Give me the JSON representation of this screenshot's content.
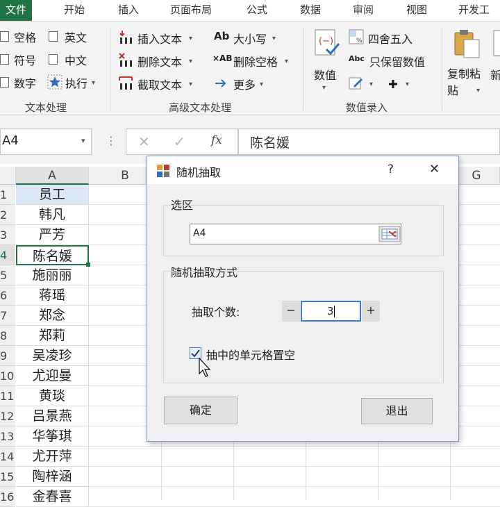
{
  "ribbon": {
    "tabs": [
      "文件",
      "开始",
      "插入",
      "页面布局",
      "公式",
      "数据",
      "审阅",
      "视图",
      "开发工"
    ],
    "text_group": {
      "label": "文本处理",
      "items": [
        "空格",
        "符号",
        "数字",
        "英文",
        "中文",
        "执行"
      ]
    },
    "advanced_group": {
      "label": "高级文本处理",
      "items": [
        "插入文本",
        "删除文本",
        "截取文本",
        "大小写",
        "删除空格",
        "更多"
      ]
    },
    "numeric_group": {
      "label": "数值录入",
      "value_button": "数值",
      "items": [
        "四舍五入",
        "只保留数值"
      ]
    },
    "copy_paste": "复制粘\n贴",
    "partial_label": "新",
    "icon_glyphs": {
      "ab": "Ab",
      "abc": "Abc",
      "x_ab": "×AB"
    }
  },
  "formula_bar": {
    "name_box": "A4",
    "fx": "fx",
    "value": "陈名媛"
  },
  "sheet": {
    "columns": [
      "A",
      "B",
      "G"
    ],
    "row_numbers": [
      "1",
      "2",
      "3",
      "4",
      "5",
      "6",
      "7",
      "8",
      "9",
      "10",
      "11",
      "12",
      "13",
      "14",
      "15",
      "16"
    ],
    "column_a": [
      "员工",
      "韩凡",
      "严芳",
      "陈名媛",
      "施丽丽",
      "蒋瑶",
      "郑念",
      "郑莉",
      "吴凌珍",
      "尤迎曼",
      "黄琰",
      "吕景燕",
      "华筝琪",
      "尤开萍",
      "陶梓涵",
      "金春喜"
    ],
    "selected_row_index": 3
  },
  "dialog": {
    "title": "随机抽取",
    "help": "?",
    "close": "✕",
    "selection_group": "选区",
    "range_value": "A4",
    "method_group": "随机抽取方式",
    "count_label": "抽取个数:",
    "minus": "−",
    "count_value": "3",
    "plus": "+",
    "clear_checkbox_label": "抽中的单元格置空",
    "clear_checked": true,
    "ok_button": "确定",
    "exit_button": "退出"
  },
  "colors": {
    "accent": "#217346",
    "dialog_border": "#7a9cc6",
    "input_focus": "#3b7bd4"
  }
}
